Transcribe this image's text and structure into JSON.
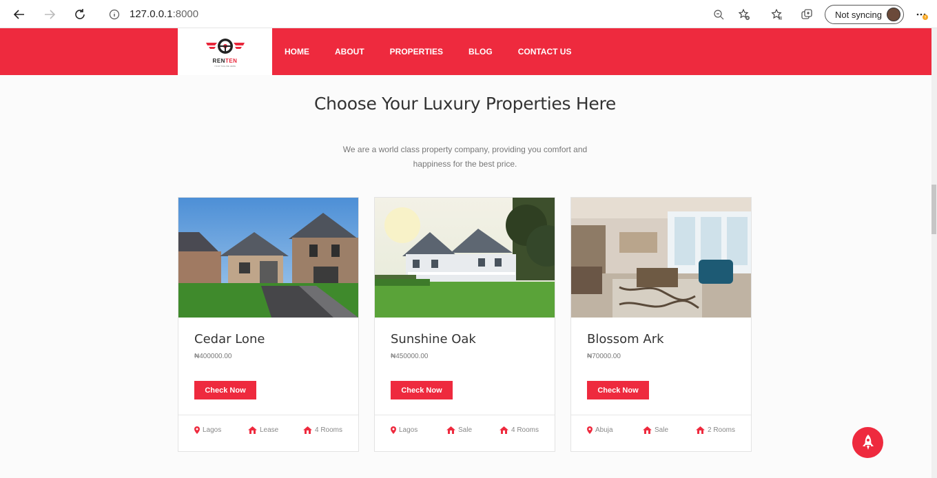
{
  "browser": {
    "url_host": "127.0.0.1",
    "url_port": ":8000",
    "sync_label": "Not syncing"
  },
  "header": {
    "logo_text_part1": "REN",
    "logo_text_part2": "TEN",
    "logo_tagline": "YOUR TAGLINE HERE",
    "nav": [
      "HOME",
      "ABOUT",
      "PROPERTIES",
      "BLOG",
      "CONTACT US"
    ]
  },
  "section": {
    "heading": "Choose Your Luxury Properties Here",
    "subtext": "We are a world class property company, providing you comfort and happiness for the best price."
  },
  "cards": [
    {
      "title": "Cedar Lone",
      "price": "₦400000.00",
      "button": "Check Now",
      "location": "Lagos",
      "type": "Lease",
      "rooms": "4 Rooms"
    },
    {
      "title": "Sunshine Oak",
      "price": "₦450000.00",
      "button": "Check Now",
      "location": "Lagos",
      "type": "Sale",
      "rooms": "4 Rooms"
    },
    {
      "title": "Blossom Ark",
      "price": "₦70000.00",
      "button": "Check Now",
      "location": "Abuja",
      "type": "Sale",
      "rooms": "2 Rooms"
    }
  ],
  "colors": {
    "brand_red": "#ee2a3e"
  },
  "icons": [
    "back-arrow-icon",
    "forward-arrow-icon",
    "reload-icon",
    "info-icon",
    "zoom-out-icon",
    "add-favorite-icon",
    "favorites-icon",
    "collections-icon",
    "more-icon",
    "map-pin-icon",
    "house-icon",
    "rocket-icon"
  ]
}
